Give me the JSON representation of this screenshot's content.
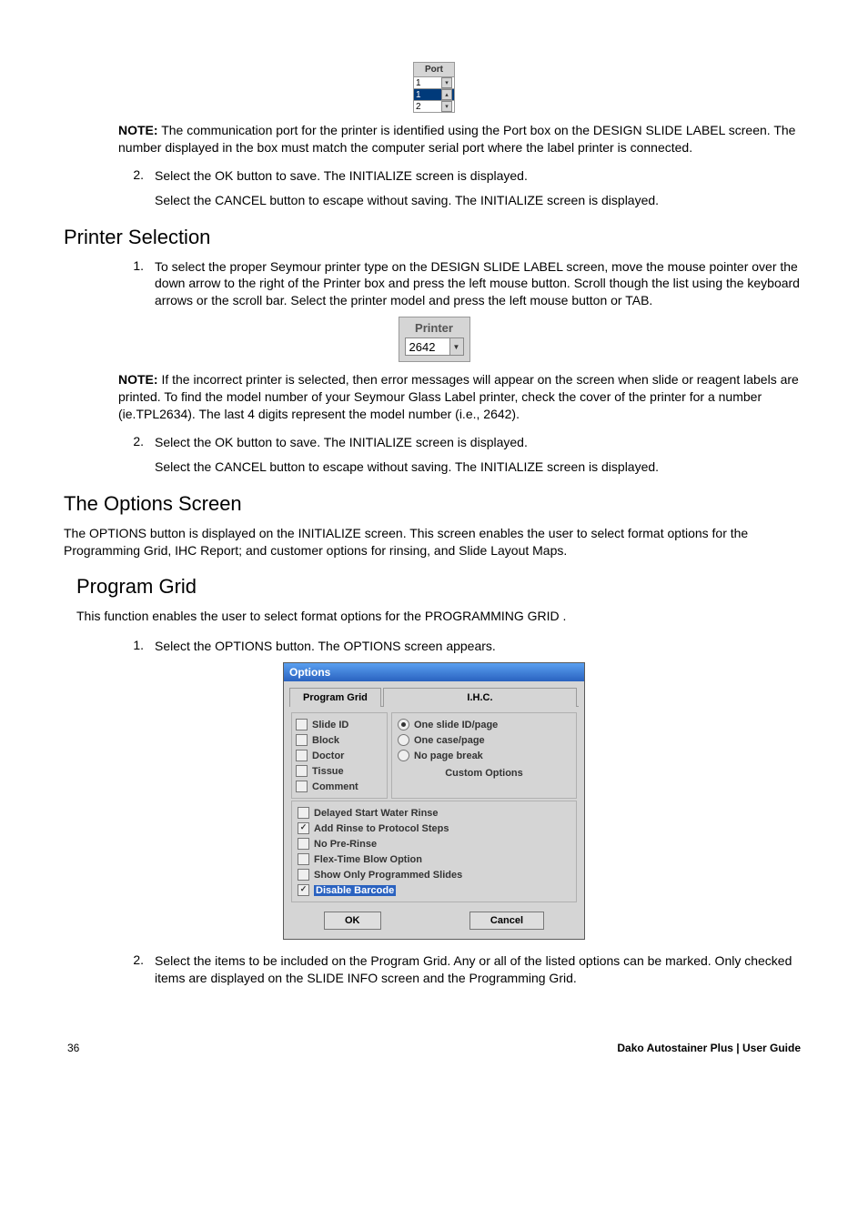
{
  "portBox": {
    "label": "Port",
    "r1": "1",
    "r2": "1",
    "r3": "2"
  },
  "note1_label": "NOTE:",
  "note1_text": "  The communication port for the printer is identified using the Port box on the DESIGN SLIDE LABEL screen. The number displayed in the box must match  the computer serial port where the label printer is connected.",
  "step_a2_num": "2.",
  "step_a2_txt": "Select the OK button to save. The INITIALIZE screen is displayed.",
  "step_a2_sub": "Select the CANCEL button to escape without saving. The INITIALIZE screen is displayed.",
  "printerSelection_heading": "Printer Selection",
  "step_b1_num": "1.",
  "step_b1_txt": "To select the proper Seymour printer type on the DESIGN SLIDE LABEL screen, move the mouse pointer over the down arrow to the right of the Printer box and press the left mouse button. Scroll though the list using the keyboard arrows or the scroll bar. Select the printer model and press the left mouse button or TAB.",
  "printerBox": {
    "label": "Printer",
    "value": "2642"
  },
  "note2_label": "NOTE:",
  "note2_text": "  If the incorrect printer is selected, then error messages will appear on the screen when slide or reagent labels are printed. To find the model number of your Seymour Glass Label printer, check the cover of the printer for a number (ie.TPL2634). The last 4 digits represent the model number (i.e., 2642).",
  "step_b2_num": "2.",
  "step_b2_txt": "Select the OK button to save. The INITIALIZE screen is displayed.",
  "step_b2_sub": "Select the CANCEL button to escape without saving. The INITIALIZE screen is displayed.",
  "optionsScreen_heading": "The Options Screen",
  "optionsScreen_para": "The OPTIONS button is displayed on the INITIALIZE screen. This screen enables the user to select format options for the Programming Grid, IHC Report; and customer options for rinsing, and Slide Layout Maps.",
  "programGrid_heading": "Program Grid",
  "programGrid_para": "This function enables the user to select format options for the PROGRAMMING GRID .",
  "step_c1_num": "1.",
  "step_c1_txt": "Select the OPTIONS button. The OPTIONS screen appears.",
  "dlg": {
    "title": "Options",
    "tab1": "Program Grid",
    "tab2": "I.H.C.",
    "left": {
      "slideId": "Slide ID",
      "block": "Block",
      "doctor": "Doctor",
      "tissue": "Tissue",
      "comment": "Comment"
    },
    "right": {
      "r1": "One slide ID/page",
      "r2": "One case/page",
      "r3": "No page break"
    },
    "customLabel": "Custom Options",
    "custom": {
      "c1": "Delayed Start Water Rinse",
      "c2": "Add Rinse to Protocol Steps",
      "c3": "No Pre-Rinse",
      "c4": "Flex-Time Blow Option",
      "c5": "Show Only Programmed Slides",
      "c6": "Disable Barcode"
    },
    "ok": "OK",
    "cancel": "Cancel"
  },
  "step_c2_num": "2.",
  "step_c2_txt": "Select the items to be included on the Program Grid. Any or all of the listed options can be marked. Only checked items are displayed on the SLIDE INFO screen and the Programming Grid.",
  "footer_page": "36",
  "footer_brand": "Dako Autostainer Plus",
  "footer_sep_guide": " | User Guide"
}
